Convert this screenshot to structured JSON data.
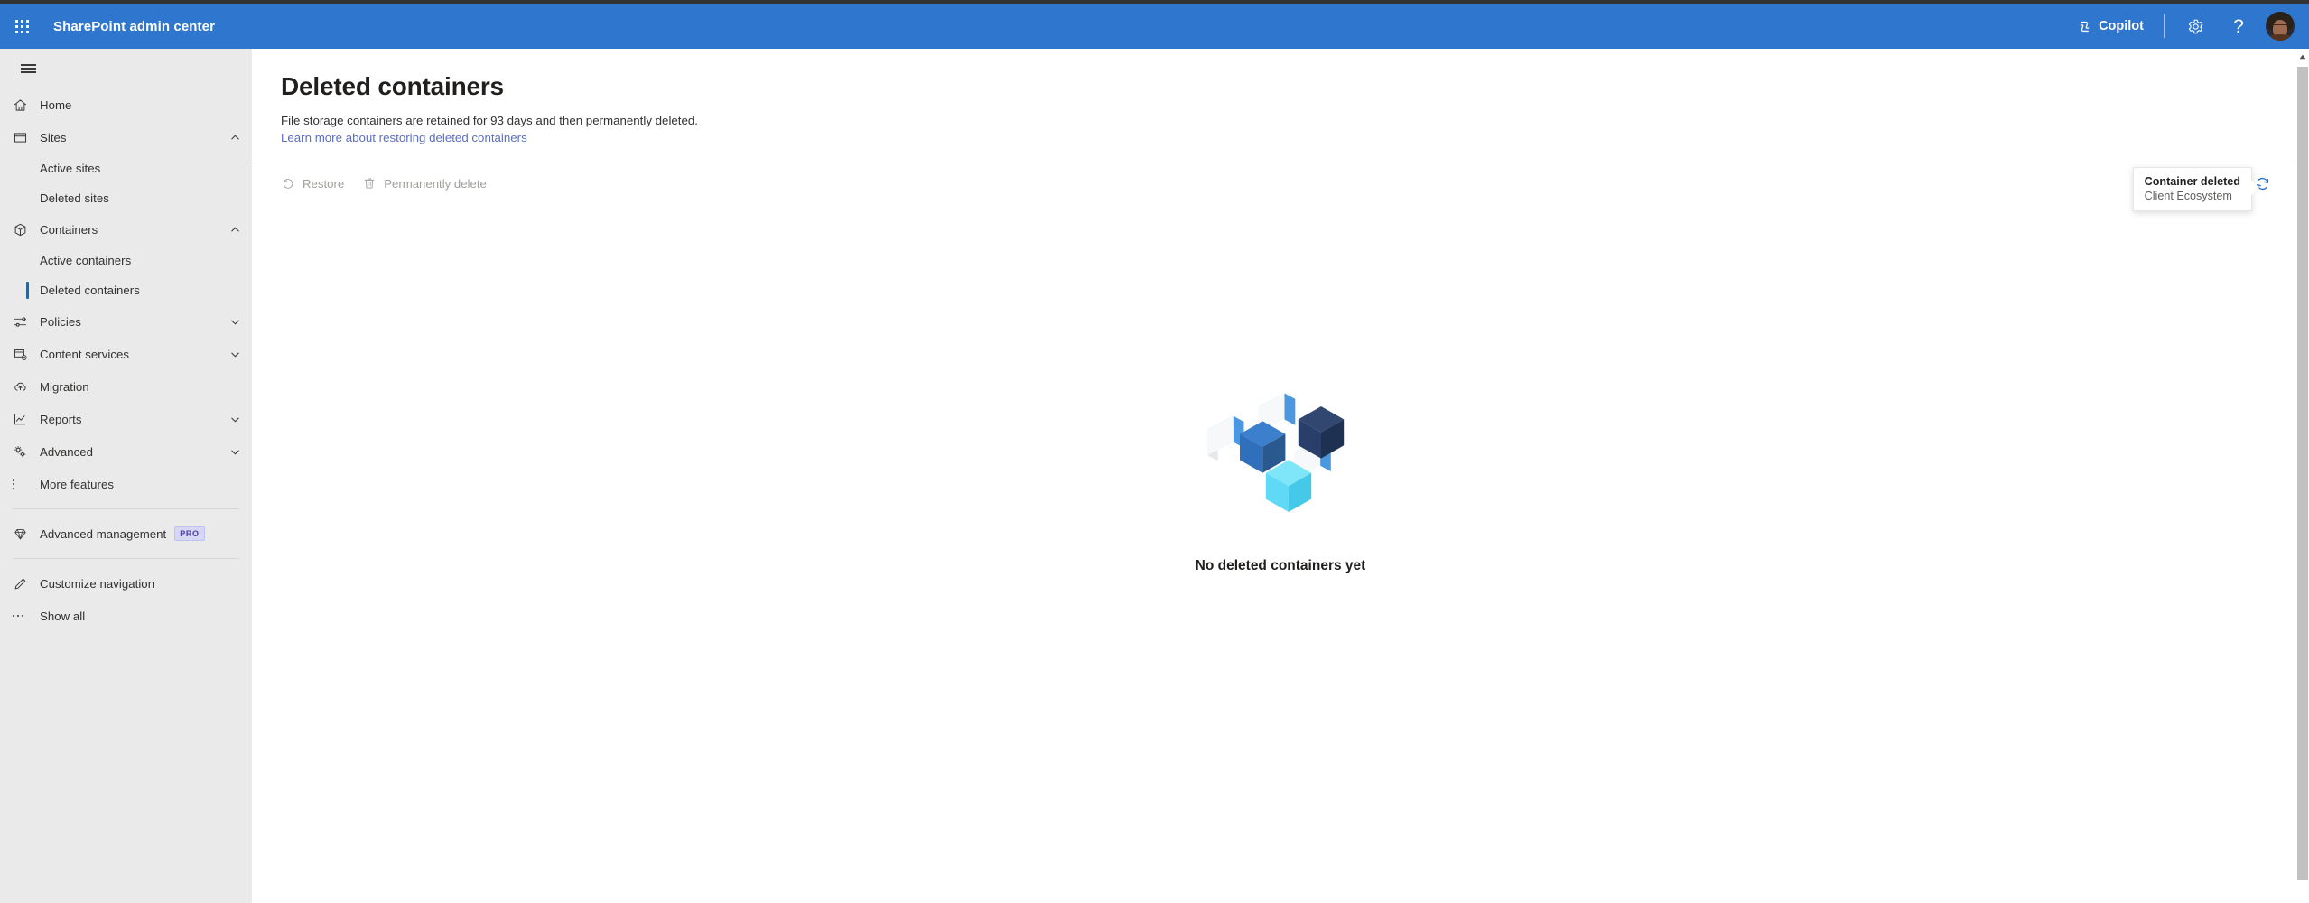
{
  "header": {
    "waffle_icon": "waffle-grid-icon",
    "title": "SharePoint admin center",
    "copilot_label": "Copilot",
    "copilot_icon": "copilot-icon",
    "settings_icon": "gear-icon",
    "help_icon": "help-question-icon",
    "avatar_label": "account-avatar",
    "background_color": "#2f77ce"
  },
  "sidebar": {
    "menu_toggle_icon": "hamburger-icon",
    "items": [
      {
        "label": "Home",
        "icon": "home-icon",
        "type": "link",
        "expanded": null,
        "selected": false
      },
      {
        "label": "Sites",
        "icon": "sites-icon",
        "type": "group",
        "expanded": true,
        "selected": false
      },
      {
        "label": "Active sites",
        "icon": "",
        "type": "sub",
        "selected": false
      },
      {
        "label": "Deleted sites",
        "icon": "",
        "type": "sub",
        "selected": false
      },
      {
        "label": "Containers",
        "icon": "container-cube-icon",
        "type": "group",
        "expanded": true,
        "selected": false
      },
      {
        "label": "Active containers",
        "icon": "",
        "type": "sub",
        "selected": false
      },
      {
        "label": "Deleted containers",
        "icon": "",
        "type": "sub",
        "selected": true
      },
      {
        "label": "Policies",
        "icon": "sliders-icon",
        "type": "group",
        "expanded": false,
        "selected": false
      },
      {
        "label": "Content services",
        "icon": "content-services-icon",
        "type": "group",
        "expanded": false,
        "selected": false
      },
      {
        "label": "Migration",
        "icon": "cloud-upload-icon",
        "type": "link",
        "selected": false
      },
      {
        "label": "Reports",
        "icon": "chart-line-icon",
        "type": "group",
        "expanded": false,
        "selected": false
      },
      {
        "label": "Advanced",
        "icon": "advanced-gears-icon",
        "type": "group",
        "expanded": false,
        "selected": false
      },
      {
        "label": "More features",
        "icon": "vertical-dots-icon",
        "type": "link",
        "selected": false
      }
    ],
    "advanced_management": {
      "label": "Advanced management",
      "icon": "diamond-icon",
      "badge": "PRO",
      "badge_color": "#4b3f9e",
      "badge_background": "#d6d6f5"
    },
    "customize_navigation": {
      "label": "Customize navigation",
      "icon": "pencil-icon"
    },
    "show_all": {
      "label": "Show all",
      "icon": "horizontal-dots-icon"
    },
    "selection_indicator_color": "#0f6cbd",
    "background_color": "#eaeaea"
  },
  "page": {
    "title": "Deleted containers",
    "description": "File storage containers are retained for 93 days and then permanently deleted.",
    "link_text": "Learn more about restoring deleted containers",
    "link_color": "#5b6fc4"
  },
  "commandbar": {
    "restore": {
      "label": "Restore",
      "icon": "restore-arrow-icon",
      "disabled": true
    },
    "permanently_delete": {
      "label": "Permanently delete",
      "icon": "trash-icon",
      "disabled": true
    },
    "refresh": {
      "label": "Refresh",
      "icon": "refresh-circular-arrows-icon",
      "color": "#2b6fd4"
    },
    "disabled_color": "#a19f9d"
  },
  "tooltip": {
    "title": "Container deleted",
    "subtitle": "Client Ecosystem"
  },
  "empty_state": {
    "illustration": "isometric-containers-illustration",
    "text": "No deleted containers yet",
    "colors": {
      "cube_medium_blue": "#2f6fbc",
      "cube_dark_navy": "#293f69",
      "cube_cyan": "#5fd9f5",
      "panel_face": "#f7f8f9",
      "panel_edge": "#3f8ede",
      "panel_edge_light": "#63c7f2"
    }
  },
  "scrollbar": {
    "up_arrow_icon": "scroll-up-arrow-icon",
    "thumb_color": "#c1c1c1"
  }
}
